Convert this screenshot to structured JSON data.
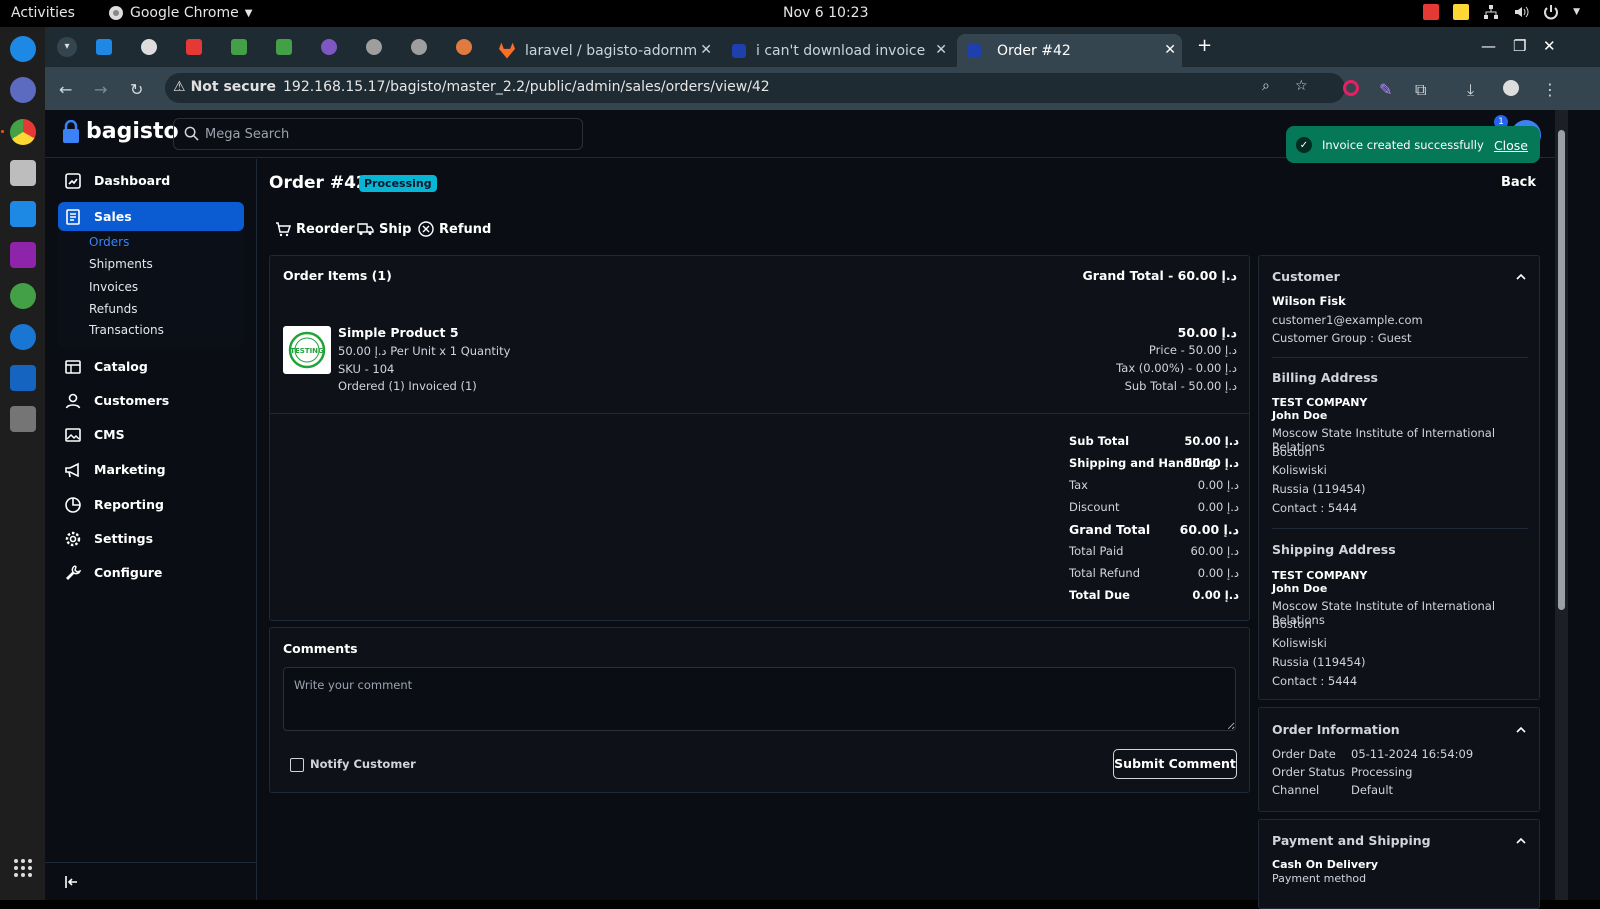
{
  "os": {
    "activities": "Activities",
    "app_name": "Google Chrome",
    "clock": "Nov 6  10:23"
  },
  "browser": {
    "tabs": [
      {
        "label": "laravel / bagisto-adornm"
      },
      {
        "label": "i can't download invoice"
      },
      {
        "label": "Order #42"
      }
    ],
    "not_secure": "Not secure",
    "url": "192.168.15.17/bagisto/master_2.2/public/admin/sales/orders/view/42"
  },
  "app": {
    "logo": "bagisto",
    "search_placeholder": "Mega Search",
    "notification_count": "1"
  },
  "sidebar": {
    "items": [
      {
        "label": "Dashboard"
      },
      {
        "label": "Sales"
      },
      {
        "label": "Catalog"
      },
      {
        "label": "Customers"
      },
      {
        "label": "CMS"
      },
      {
        "label": "Marketing"
      },
      {
        "label": "Reporting"
      },
      {
        "label": "Settings"
      },
      {
        "label": "Configure"
      }
    ],
    "sales_sub": [
      {
        "label": "Orders"
      },
      {
        "label": "Shipments"
      },
      {
        "label": "Invoices"
      },
      {
        "label": "Refunds"
      },
      {
        "label": "Transactions"
      }
    ]
  },
  "toast": {
    "message": "Invoice created successfully",
    "close": "Close"
  },
  "page": {
    "title": "Order #42",
    "status": "Processing",
    "back": "Back",
    "actions": {
      "reorder": "Reorder",
      "ship": "Ship",
      "refund": "Refund"
    }
  },
  "order_items": {
    "heading": "Order Items (1)",
    "grand_total": "Grand Total - 60.00 د.إ",
    "item": {
      "name": "Simple Product 5",
      "unit_line": "50.00 د.إ Per Unit x 1 Quantity",
      "sku": "SKU - 104",
      "status": "Ordered (1) Invoiced (1)",
      "amount": "50.00 د.إ",
      "price": "Price - 50.00 د.إ",
      "tax": "Tax (0.00%) - 0.00 د.إ",
      "sub_total": "Sub Total - 50.00 د.إ",
      "image_text": "TESTING"
    }
  },
  "summary": [
    {
      "label": "Sub Total",
      "value": "50.00 د.إ",
      "bold": true
    },
    {
      "label": "Shipping and Handling",
      "value": "50.00 د.إ",
      "bold": true
    },
    {
      "label": "Tax",
      "value": "0.00 د.إ",
      "bold": false
    },
    {
      "label": "Discount",
      "value": "0.00 د.إ",
      "bold": false
    },
    {
      "label": "Grand Total",
      "value": "60.00 د.إ",
      "bold": true,
      "big": true
    },
    {
      "label": "Total Paid",
      "value": "60.00 د.إ",
      "bold": false
    },
    {
      "label": "Total Refund",
      "value": "0.00 د.إ",
      "bold": false
    },
    {
      "label": "Total Due",
      "value": "0.00 د.إ",
      "bold": true
    }
  ],
  "comments": {
    "heading": "Comments",
    "placeholder": "Write your comment",
    "notify": "Notify Customer",
    "submit": "Submit Comment"
  },
  "customer": {
    "heading": "Customer",
    "name": "Wilson Fisk",
    "email": "customer1@example.com",
    "group": "Customer Group : Guest"
  },
  "billing": {
    "heading": "Billing Address",
    "company": "TEST COMPANY",
    "name": "John Doe",
    "line1": "Moscow State Institute of International Relations",
    "city": "Boston",
    "state": "Koliswiski",
    "country": "Russia (119454)",
    "contact": "Contact : 5444"
  },
  "shipping": {
    "heading": "Shipping Address",
    "company": "TEST COMPANY",
    "name": "John Doe",
    "line1": "Moscow State Institute of International Relations",
    "city": "Boston",
    "state": "Koliswiski",
    "country": "Russia (119454)",
    "contact": "Contact : 5444"
  },
  "order_info": {
    "heading": "Order Information",
    "rows": [
      {
        "label": "Order Date",
        "value": "05-11-2024 16:54:09"
      },
      {
        "label": "Order Status",
        "value": "Processing"
      },
      {
        "label": "Channel",
        "value": "Default"
      }
    ]
  },
  "payment": {
    "heading": "Payment and Shipping",
    "method": "Cash On Delivery",
    "method_label": "Payment method"
  },
  "colors": {
    "accent": "#0b5bd3",
    "toast": "#047857",
    "badge": "#06b6d4"
  }
}
